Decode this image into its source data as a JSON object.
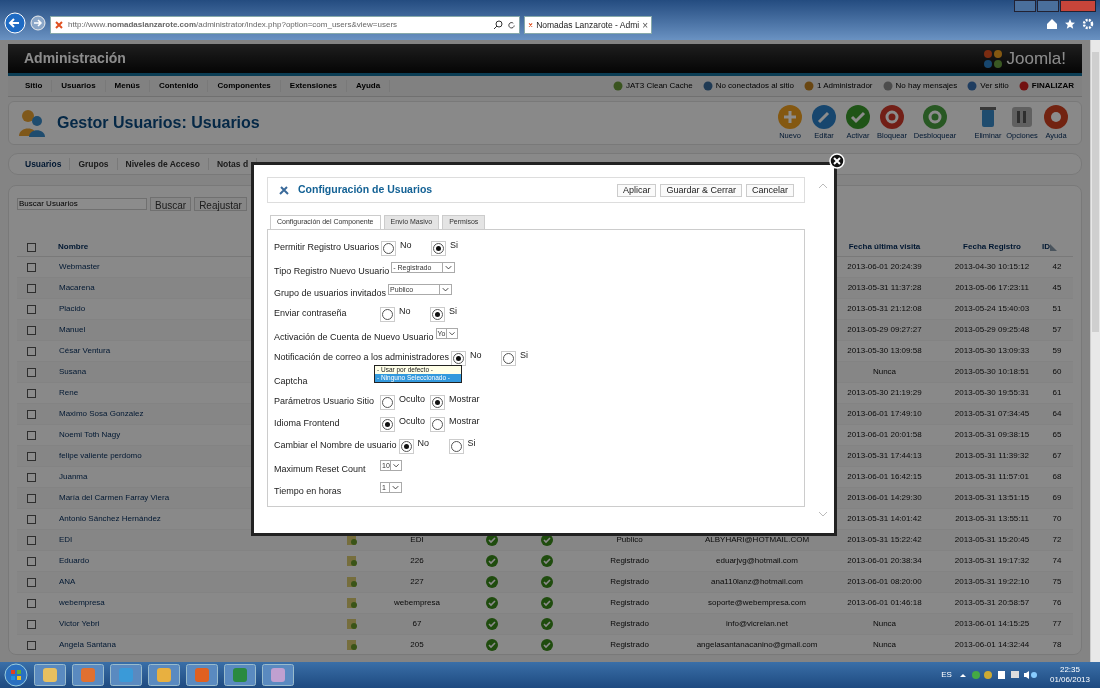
{
  "browser": {
    "address": "http://www.**nomadaslanzarote.com**/administrator/index.php?option=com_users&view=users",
    "tab": {
      "title": "Nomadas Lanzarote - Admi",
      "close": "×"
    }
  },
  "header": {
    "title": "Administración",
    "logo": "Joomla!"
  },
  "menu": [
    "Sitio",
    "Usuarios",
    "Menús",
    "Contenido",
    "Componentes",
    "Extensiones",
    "Ayuda"
  ],
  "status": [
    {
      "kind": "cache",
      "label": "JAT3 Clean Cache"
    },
    {
      "kind": "users",
      "label": "No conectados al sitio"
    },
    {
      "kind": "user",
      "label": "1 Administrador"
    },
    {
      "kind": "mail",
      "label": "No hay mensajes"
    },
    {
      "kind": "view",
      "label": "Ver sitio"
    },
    {
      "kind": "logout",
      "label": "FINALIZAR"
    }
  ],
  "toolbar": {
    "title": "Gestor Usuarios: Usuarios",
    "buttons": [
      {
        "kind": "new",
        "label": "Nuevo"
      },
      {
        "kind": "edit",
        "label": "Editar"
      },
      {
        "kind": "activate",
        "label": "Activar"
      },
      {
        "kind": "block",
        "label": "Bloquear"
      },
      {
        "kind": "unblock",
        "label": "Desbloquear"
      },
      {
        "kind": "delete",
        "label": "Eliminar"
      },
      {
        "kind": "options",
        "label": "Opciones"
      },
      {
        "kind": "help",
        "label": "Ayuda"
      }
    ]
  },
  "subtabs": [
    {
      "label": "Usuarios",
      "selected": true
    },
    {
      "label": "Grupos",
      "selected": false
    },
    {
      "label": "Niveles de Acceso",
      "selected": false
    },
    {
      "label": "Notas d",
      "selected": false
    }
  ],
  "filter": {
    "value": "Buscar Usuarios",
    "buttons": [
      "Buscar",
      "Reajustar"
    ]
  },
  "table": {
    "all_checked": false,
    "columns": {
      "name": "Nombre",
      "last_visit": "Fecha última visita",
      "registered": "Fecha Registro",
      "id": "ID"
    },
    "rows": [
      {
        "checked": false,
        "name": "Webmaster",
        "last_visit": "2013-06-01 20:24:39",
        "registered": "2013-04-30 10:15:12",
        "id": "42"
      },
      {
        "checked": false,
        "name": "Macarena",
        "last_visit": "2013-05-31 11:37:28",
        "registered": "2013-05-06 17:23:11",
        "id": "45"
      },
      {
        "checked": false,
        "name": "Placido",
        "last_visit": "2013-05-31 21:12:08",
        "registered": "2013-05-24 15:40:03",
        "id": "51"
      },
      {
        "checked": false,
        "name": "Manuel",
        "last_visit": "2013-05-29 09:27:27",
        "registered": "2013-05-29 09:25:48",
        "id": "57"
      },
      {
        "checked": false,
        "name": "César Ventura",
        "last_visit": "2013-05-30 13:09:58",
        "registered": "2013-05-30 13:09:33",
        "id": "59"
      },
      {
        "checked": false,
        "name": "Susana",
        "last_visit": "Nunca",
        "registered": "2013-05-30 10:18:51",
        "id": "60"
      },
      {
        "checked": false,
        "name": "Rene",
        "last_visit": "2013-05-30 21:19:29",
        "registered": "2013-05-30 19:55:31",
        "id": "61"
      },
      {
        "checked": false,
        "name": "Maximo Sosa Gonzalez",
        "last_visit": "2013-06-01 17:49:10",
        "registered": "2013-05-31 07:34:45",
        "id": "64"
      },
      {
        "checked": false,
        "name": "Noemi Toth Nagy",
        "last_visit": "2013-06-01 20:01:58",
        "registered": "2013-05-31 09:38:15",
        "id": "65"
      },
      {
        "checked": false,
        "name": "felipe valiente perdomo",
        "last_visit": "2013-05-31 17:44:13",
        "registered": "2013-05-31 11:39:32",
        "id": "67"
      },
      {
        "checked": false,
        "name": "Juanma",
        "last_visit": "2013-06-01 16:42:15",
        "registered": "2013-05-31 11:57:01",
        "id": "68"
      },
      {
        "checked": false,
        "name": "María del Carmen Farray Viera",
        "last_visit": "2013-06-01 14:29:30",
        "registered": "2013-05-31 13:51:15",
        "id": "69"
      },
      {
        "checked": false,
        "name": "Antonio Sánchez Hernández",
        "last_visit": "2013-05-31 14:01:42",
        "registered": "2013-05-31 13:55:11",
        "id": "70"
      },
      {
        "checked": false,
        "name": "EDI",
        "username": "EDI",
        "enabled": true,
        "activated": true,
        "group": "Publico",
        "email": "ALBYHARI@HOTMAIL.COM",
        "last_visit": "2013-05-31 15:22:42",
        "registered": "2013-05-31 15:20:45",
        "id": "72"
      },
      {
        "checked": false,
        "name": "Eduardo",
        "username": "226",
        "enabled": true,
        "activated": true,
        "group": "Registrado",
        "email": "eduarjvg@hotmail.com",
        "last_visit": "2013-06-01 20:38:34",
        "registered": "2013-05-31 19:17:32",
        "id": "74"
      },
      {
        "checked": false,
        "name": "ANA",
        "username": "227",
        "enabled": true,
        "activated": true,
        "group": "Registrado",
        "email": "ana110lanz@hotmail.com",
        "last_visit": "2013-06-01 08:20:00",
        "registered": "2013-05-31 19:22:10",
        "id": "75"
      },
      {
        "checked": false,
        "name": "webempresa",
        "username": "webempresa",
        "enabled": true,
        "activated": true,
        "group": "Registrado",
        "email": "soporte@webempresa.com",
        "last_visit": "2013-06-01 01:46:18",
        "registered": "2013-05-31 20:58:57",
        "id": "76"
      },
      {
        "checked": false,
        "name": "Victor Yebri",
        "username": "67",
        "enabled": true,
        "activated": true,
        "group": "Registrado",
        "email": "info@vicrelan.net",
        "last_visit": "Nunca",
        "registered": "2013-06-01 14:15:25",
        "id": "77"
      },
      {
        "checked": false,
        "name": "Angela Santana",
        "username": "205",
        "enabled": true,
        "activated": true,
        "group": "Registrado",
        "email": "angelasantanacanino@gmail.com",
        "last_visit": "Nunca",
        "registered": "2013-06-01 14:32:44",
        "id": "78"
      }
    ]
  },
  "modal": {
    "title": "Configuración de Usuarios",
    "buttons": [
      "Aplicar",
      "Guardar & Cerrar",
      "Cancelar"
    ],
    "tabs": [
      {
        "label": "Configuración del Componente",
        "selected": true
      },
      {
        "label": "Envio Masivo",
        "selected": false
      },
      {
        "label": "Permisos",
        "selected": false
      }
    ],
    "fields": [
      {
        "kind": "radio",
        "label": "Permitir Registro Usuarios",
        "options": [
          {
            "label": "No",
            "selected": false
          },
          {
            "label": "Si",
            "selected": true
          }
        ]
      },
      {
        "kind": "select",
        "label": "Tipo Registro Nuevo Usuario",
        "value": "- Registrado"
      },
      {
        "kind": "select",
        "label": "Grupo de usuarios invitados",
        "value": "Publico"
      },
      {
        "kind": "radio",
        "label": "Enviar contraseña",
        "options": [
          {
            "label": "No",
            "selected": false
          },
          {
            "label": "Si",
            "selected": true
          }
        ]
      },
      {
        "kind": "select",
        "label": "Activación de Cuenta de Nuevo Usuario",
        "value": "Yo"
      },
      {
        "kind": "radio",
        "label": "Notificación de correo a los administradores",
        "options": [
          {
            "label": "No",
            "selected": true
          },
          {
            "label": "Si",
            "selected": false
          }
        ]
      },
      {
        "kind": "listbox",
        "label": "Captcha",
        "options": [
          {
            "label": "- Usar por defecto -",
            "selected": false
          },
          {
            "label": "- Ninguno Seleccionado -",
            "selected": true
          }
        ]
      },
      {
        "kind": "radio",
        "label": "Parámetros Usuario Sitio",
        "options": [
          {
            "label": "Oculto",
            "selected": false
          },
          {
            "label": "Mostrar",
            "selected": true
          }
        ]
      },
      {
        "kind": "radio",
        "label": "Idioma Frontend",
        "options": [
          {
            "label": "Oculto",
            "selected": true
          },
          {
            "label": "Mostrar",
            "selected": false
          }
        ]
      },
      {
        "kind": "radio",
        "label": "Cambiar el Nombre de usuario",
        "options": [
          {
            "label": "No",
            "selected": true
          },
          {
            "label": "Si",
            "selected": false
          }
        ]
      },
      {
        "kind": "select",
        "label": "Maximum Reset Count",
        "value": "10"
      },
      {
        "kind": "select",
        "label": "Tiempo en horas",
        "value": "1"
      }
    ]
  },
  "taskbar": {
    "language": "ES",
    "time": "22:35",
    "date": "01/06/2013"
  }
}
